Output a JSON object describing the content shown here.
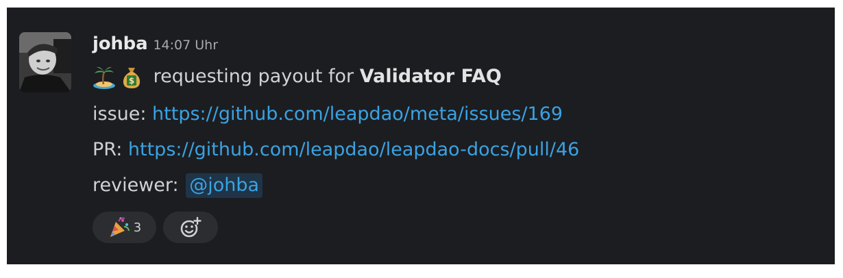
{
  "message": {
    "author": "johba",
    "timestamp": "14:07 Uhr",
    "line1": {
      "emoji_1": "palm-island-icon",
      "emoji_2": "money-bag-icon",
      "text": " requesting payout for ",
      "bold": "Validator FAQ"
    },
    "line2": {
      "label": "issue: ",
      "link": "https://github.com/leapdao/meta/issues/169"
    },
    "line3": {
      "label": "PR: ",
      "link": "https://github.com/leapdao/leapdao-docs/pull/46"
    },
    "line4": {
      "label": "reviewer: ",
      "mention": "@johba"
    }
  },
  "reactions": [
    {
      "icon": "party-popper-icon",
      "count": "3"
    }
  ],
  "add_reaction": {
    "icon": "add-reaction-icon"
  },
  "colors": {
    "background": "#1c1d21",
    "link": "#3aa3e3",
    "mention_bg": "#1f3447",
    "reaction_bg": "#2c2d31"
  }
}
